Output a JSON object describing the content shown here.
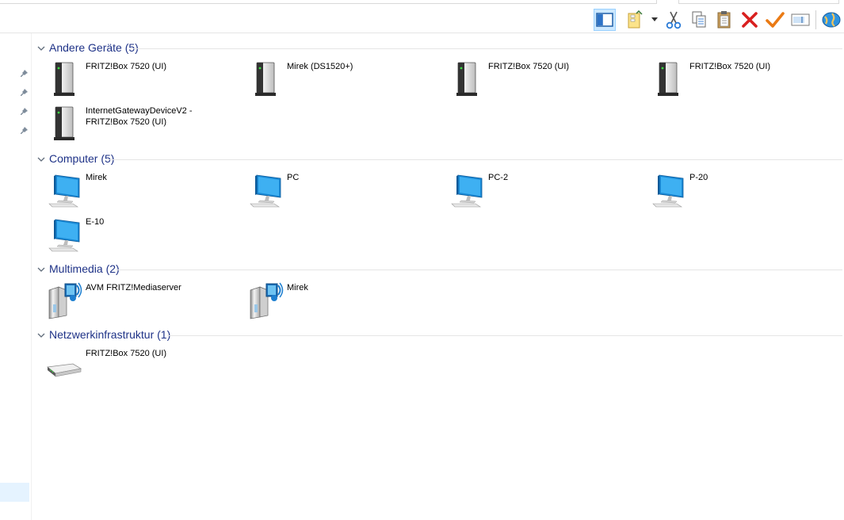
{
  "toolbar": {
    "icons": [
      "preview-pane-icon",
      "new-folder-icon",
      "dropdown-arrow-icon",
      "cut-icon",
      "copy-icon",
      "paste-icon",
      "delete-icon",
      "checkmark-icon",
      "rename-icon",
      "globe-icon"
    ]
  },
  "groups": [
    {
      "title": "Andere Geräte (5)",
      "items": [
        {
          "label": "FRITZ!Box 7520 (UI)",
          "icon": "server-icon"
        },
        {
          "label": "Mirek (DS1520+)",
          "icon": "server-icon"
        },
        {
          "label": "FRITZ!Box 7520 (UI)",
          "icon": "server-icon"
        },
        {
          "label": "FRITZ!Box 7520 (UI)",
          "icon": "server-icon"
        },
        {
          "label": "InternetGatewayDeviceV2 - FRITZ!Box 7520 (UI)",
          "icon": "server-icon"
        }
      ]
    },
    {
      "title": "Computer (5)",
      "items": [
        {
          "label": "Mirek",
          "icon": "computer-icon"
        },
        {
          "label": "PC",
          "icon": "computer-icon"
        },
        {
          "label": "PC-2",
          "icon": "computer-icon"
        },
        {
          "label": "P-20",
          "icon": "computer-icon"
        },
        {
          "label": "E-10",
          "icon": "computer-icon"
        }
      ]
    },
    {
      "title": "Multimedia (2)",
      "items": [
        {
          "label": "AVM FRITZ!Mediaserver",
          "icon": "media-server-icon"
        },
        {
          "label": "Mirek",
          "icon": "media-server-icon"
        }
      ]
    },
    {
      "title": "Netzwerkinfrastruktur (1)",
      "items": [
        {
          "label": "FRITZ!Box 7520 (UI)",
          "icon": "router-icon"
        }
      ]
    }
  ],
  "colors": {
    "group_title": "#1e3287",
    "selection": "#cce8ff"
  }
}
